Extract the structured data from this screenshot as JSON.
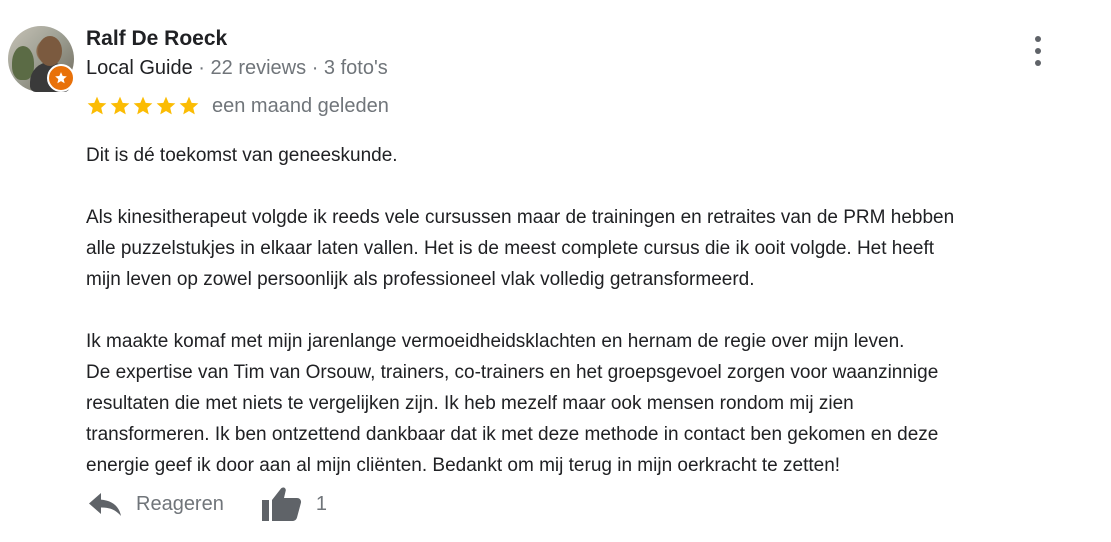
{
  "reviewer": {
    "name": "Ralf De Roeck",
    "badge_icon": "local-guide-star-icon",
    "meta": {
      "level": "Local Guide",
      "separator": " · ",
      "reviews": "22 reviews",
      "photos": "3 foto's"
    }
  },
  "rating": {
    "value": 5,
    "max": 5,
    "star_color": "#fbbc04",
    "time": "een maand geleden"
  },
  "review": {
    "paragraphs": [
      [
        "Dit is dé toekomst van geneeskunde."
      ],
      [
        "Als kinesitherapeut volgde ik reeds vele cursussen maar de trainingen en retraites van de PRM hebben",
        "alle puzzelstukjes in elkaar laten vallen. Het is de meest complete cursus die ik ooit volgde. Het heeft",
        "mijn leven op zowel persoonlijk als professioneel vlak volledig getransformeerd."
      ],
      [
        "Ik maakte komaf met mijn jarenlange vermoeidheidsklachten en hernam de regie over mijn leven.",
        "De expertise van Tim van Orsouw,  trainers, co-trainers en het groepsgevoel zorgen voor waanzinnige",
        "resultaten die met niets te vergelijken zijn. Ik heb mezelf maar ook mensen rondom mij zien",
        "transformeren. Ik ben ontzettend dankbaar dat ik met deze methode in contact ben gekomen en deze",
        "energie geef ik door aan al mijn cliënten. Bedankt om mij terug in mijn oerkracht te zetten!"
      ]
    ]
  },
  "actions": {
    "reply_label": "Reageren",
    "reply_icon": "reply-arrow-icon",
    "like_icon": "thumbs-up-icon",
    "like_count": "1"
  },
  "menu_icon": "more-vert-icon",
  "colors": {
    "text_primary": "#202124",
    "text_secondary": "#70757a",
    "icon_gray": "#5f6368",
    "guide_badge": "#e8710a"
  }
}
